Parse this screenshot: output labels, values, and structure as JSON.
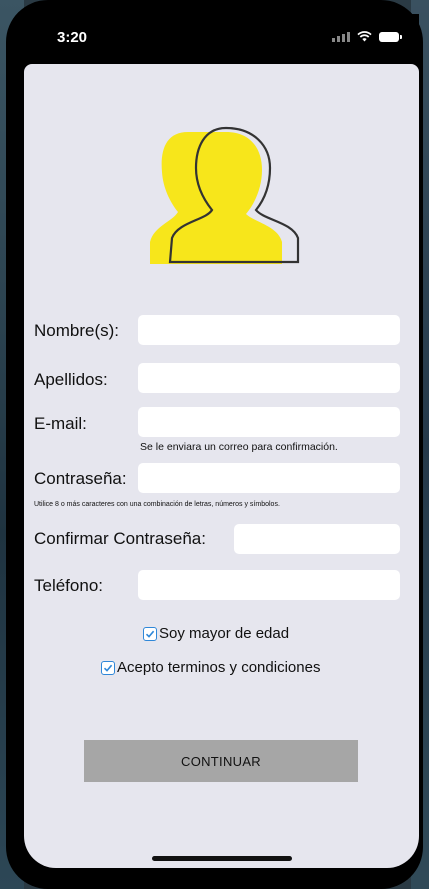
{
  "status_bar": {
    "time": "3:20"
  },
  "form": {
    "nombre_label": "Nombre(s):",
    "apellidos_label": "Apellidos:",
    "email_label": "E-mail:",
    "email_hint": "Se le enviara un correo para confirmación.",
    "password_label": "Contraseña:",
    "password_hint": "Utilice 8 o más caracteres con una combinación de letras, números y símbolos.",
    "confirm_password_label": "Confirmar Contraseña:",
    "phone_label": "Teléfono:",
    "adult_checkbox_label": "Soy mayor de edad",
    "adult_checked": true,
    "terms_checkbox_label": "Acepto terminos y condiciones",
    "terms_checked": true,
    "continue_label": "CONTINUAR"
  },
  "colors": {
    "avatar_fill": "#f7e61b",
    "screen_bg": "#e6e6ee",
    "button_bg": "#a6a6a6",
    "checkbox_accent": "#2f87d8"
  },
  "icons": {
    "avatar": "user-silhouette-icon",
    "checkmark": "checkmark-icon",
    "wifi": "wifi-icon",
    "battery": "battery-icon",
    "signal": "signal-icon"
  }
}
